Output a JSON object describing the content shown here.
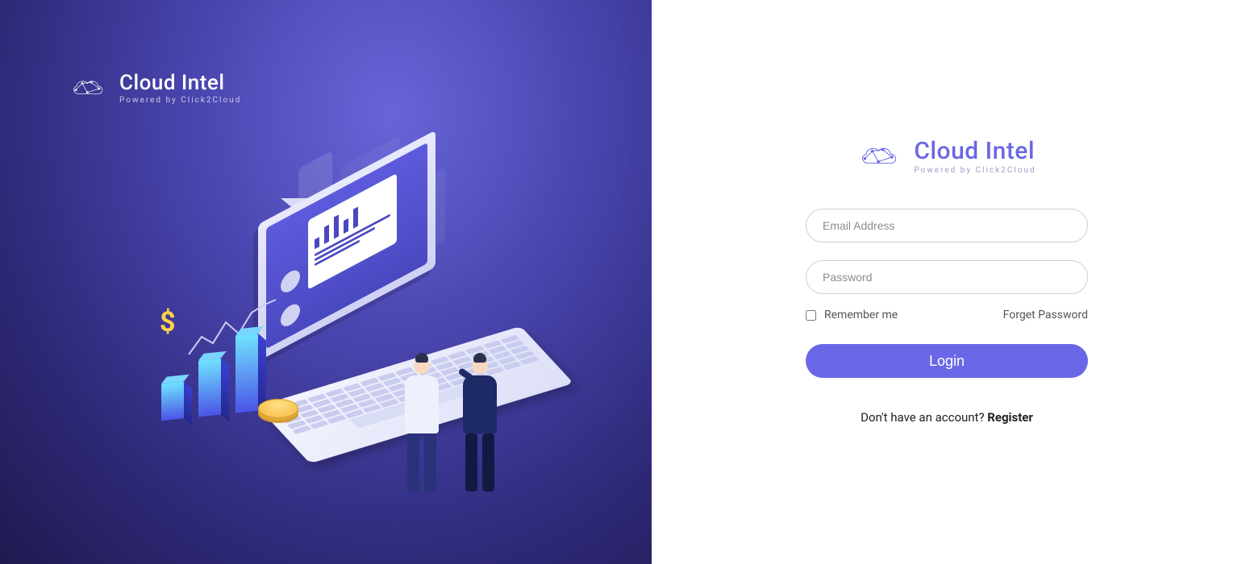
{
  "brand": {
    "title": "Cloud Intel",
    "subtitle": "Powered by Click2Cloud"
  },
  "login": {
    "email_placeholder": "Email Address",
    "password_placeholder": "Password",
    "remember_label": "Remember me",
    "forgot_label": "Forget Password",
    "submit_label": "Login",
    "register_prompt": "Don't have an account? ",
    "register_action": "Register",
    "email_value": "",
    "password_value": "",
    "remember_checked": false
  },
  "colors": {
    "accent": "#6a67e6",
    "left_bg_start": "#6965d8",
    "left_bg_end": "#1f1a4f",
    "gold": "#ffd24a"
  }
}
